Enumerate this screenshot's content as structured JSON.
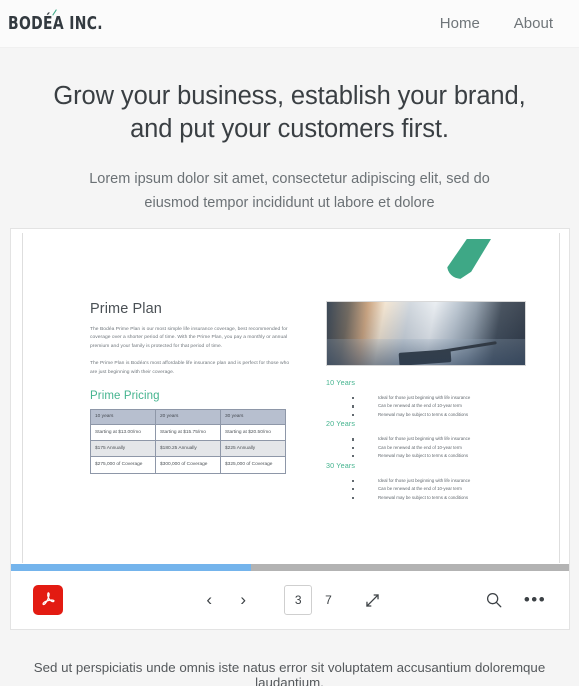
{
  "header": {
    "logo": "BODÉA INC.",
    "logo_accent_color": "#3ea886",
    "nav": [
      {
        "label": "Home"
      },
      {
        "label": "About"
      }
    ]
  },
  "hero": {
    "heading_line1": "Grow your business, establish your brand,",
    "heading_line2": "and put your customers first.",
    "subheading": "Lorem ipsum dolor sit amet, consectetur adipiscing elit, sed do eiusmod tempor incididunt ut labore et dolore"
  },
  "pdf_document": {
    "accent_color": "#3ea886",
    "title": "Prime Plan",
    "paragraphs": [
      "The Bodéa Prime Plan is our most simple life insurance coverage, best recommended for coverage over a shorter period of time. With the Prime Plan, you pay a monthly or annual premium and your family is protected for that period of time.",
      "The Prime Plan is Bodéa's most affordable life insurance plan and is perfect for those who are just beginning with their coverage."
    ],
    "pricing_heading": "Prime Pricing",
    "pricing_table": {
      "headers": [
        "10 years",
        "20 years",
        "30 years"
      ],
      "rows": [
        [
          "Starting at $13.00/mo",
          "Starting at $15.75/mo",
          "Starting at $20.50/mo"
        ],
        [
          "$175 Annually",
          "$180.25 Annually",
          "$225 Annually"
        ],
        [
          "$275,000 of Coverage",
          "$300,000 of Coverage",
          "$325,000 of Coverage"
        ]
      ]
    },
    "photo_alt": "hands-reviewing-documents-photo",
    "term_sections": [
      {
        "heading": "10 Years",
        "bullets": [
          "Ideal for those just beginning with life insurance",
          "Can be renewed at the end of 10-year term",
          "Renewal may be subject to terms & conditions"
        ]
      },
      {
        "heading": "20 Years",
        "bullets": [
          "Ideal for those just beginning with life insurance",
          "Can be renewed at the end of 10-year term",
          "Renewal may be subject to terms & conditions"
        ]
      },
      {
        "heading": "30 Years",
        "bullets": [
          "Ideal for those just beginning with life insurance",
          "Can be renewed at the end of 10-year term",
          "Renewal may be subject to terms & conditions"
        ]
      }
    ]
  },
  "viewer_toolbar": {
    "progress_percent": 43,
    "progress_fill_color": "#74b4ec",
    "progress_track_color": "#b3b3b3",
    "pdf_badge_color": "#e31b12",
    "prev_label": "‹",
    "next_label": "›",
    "current_page": "3",
    "total_pages": "7",
    "more_label": "•••"
  },
  "footer": {
    "text": "Sed ut perspiciatis unde omnis iste natus error sit voluptatem accusantium doloremque laudantium,"
  }
}
